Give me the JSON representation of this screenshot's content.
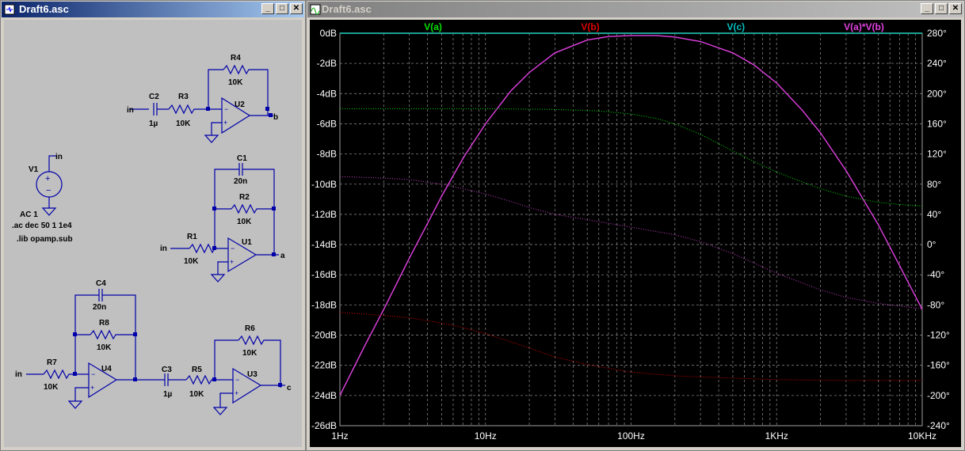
{
  "schematic_window": {
    "title": "Draft6.asc",
    "buttons": {
      "minimize": "_",
      "maximize": "□",
      "close": "✕"
    },
    "labels": {
      "r4": "R4",
      "r4_val": "10K",
      "c2": "C2",
      "c2_val": "1µ",
      "r3": "R3",
      "r3_val": "10K",
      "u2": "U2",
      "in1": "in",
      "out_b": "b",
      "v1": "V1",
      "v1_net": "in",
      "v1_ac": "AC 1",
      "ac_cmd": ".ac dec 50 1 1e4",
      "lib_cmd": ".lib opamp.sub",
      "c1": "C1",
      "c1_val": "20n",
      "r2": "R2",
      "r2_val": "10K",
      "r1": "R1",
      "r1_val": "10K",
      "in2": "in",
      "u1": "U1",
      "out_a": "a",
      "c4": "C4",
      "c4_val": "20n",
      "r8": "R8",
      "r8_val": "10K",
      "r7": "R7",
      "r7_val": "10K",
      "in3": "in",
      "u4": "U4",
      "c3": "C3",
      "c3_val": "1µ",
      "r5": "R5",
      "r5_val": "10K",
      "r6": "R6",
      "r6_val": "10K",
      "u3": "U3",
      "out_c": "c"
    }
  },
  "plot_window": {
    "title": "Draft6.asc",
    "buttons": {
      "minimize": "_",
      "maximize": "□",
      "close": "✕"
    },
    "trace_colors": {
      "V(a)": "#00e000",
      "V(b)": "#e00000",
      "V(c)": "#00c0c0",
      "V(a)*V(b)": "#e040e0"
    }
  },
  "chart_data": {
    "type": "line",
    "x_scale": "log",
    "xlim": [
      1,
      10000
    ],
    "xticks": [
      "1Hz",
      "10Hz",
      "100Hz",
      "1KHz",
      "10KHz"
    ],
    "ylim_left": [
      -26,
      0
    ],
    "yticks_left": [
      "0dB",
      "-2dB",
      "-4dB",
      "-6dB",
      "-8dB",
      "-10dB",
      "-12dB",
      "-14dB",
      "-16dB",
      "-18dB",
      "-20dB",
      "-22dB",
      "-24dB",
      "-26dB"
    ],
    "ylim_right": [
      -240,
      280
    ],
    "yticks_right": [
      "280°",
      "240°",
      "200°",
      "160°",
      "120°",
      "80°",
      "40°",
      "0°",
      "-40°",
      "-80°",
      "-120°",
      "-160°",
      "-200°",
      "-240°"
    ],
    "series": [
      {
        "name": "V(a)",
        "color": "#00e000",
        "style": "solid",
        "x": [
          1,
          10000
        ],
        "y": [
          0,
          0
        ]
      },
      {
        "name": "V(b)",
        "color": "#e00000",
        "style": "solid",
        "x": [
          1,
          10000
        ],
        "y": [
          0,
          0
        ]
      },
      {
        "name": "V(c)",
        "color": "#00c0c0",
        "style": "solid",
        "x": [
          1,
          10000
        ],
        "y": [
          0,
          0
        ]
      },
      {
        "name": "V(a)*V(b)",
        "color": "#e040e0",
        "style": "solid",
        "x": [
          1,
          1.5,
          2,
          3,
          4,
          5,
          7,
          10,
          15,
          20,
          30,
          50,
          70,
          100,
          150,
          200,
          300,
          500,
          700,
          1000,
          1500,
          2000,
          3000,
          5000,
          7000,
          10000
        ],
        "y": [
          -24,
          -20.6,
          -18.3,
          -14.9,
          -12.6,
          -10.8,
          -8.3,
          -6.0,
          -3.8,
          -2.6,
          -1.3,
          -0.45,
          -0.22,
          -0.15,
          -0.15,
          -0.25,
          -0.55,
          -1.3,
          -2.1,
          -3.3,
          -5.1,
          -6.6,
          -9.1,
          -12.7,
          -15.4,
          -18.3
        ]
      },
      {
        "name": "V(a) phase",
        "color": "#00e000",
        "style": "dotted",
        "axis": "right",
        "x": [
          1,
          3,
          10,
          30,
          60,
          100,
          150,
          200,
          300,
          500,
          700,
          1000,
          1500,
          2000,
          3000,
          5000,
          7000,
          10000
        ],
        "y": [
          180,
          180,
          180,
          179,
          177,
          173,
          167,
          160,
          146,
          124,
          110,
          96,
          83,
          74,
          64,
          56,
          53,
          51
        ]
      },
      {
        "name": "V(b) phase",
        "color": "#e00000",
        "style": "dotted",
        "axis": "right",
        "x": [
          1,
          2,
          3,
          5,
          7,
          10,
          15,
          20,
          30,
          50,
          70,
          100,
          200,
          500,
          1000,
          3000,
          10000
        ],
        "y": [
          -90,
          -94,
          -97,
          -104,
          -110,
          -118,
          -129,
          -137,
          -149,
          -159,
          -164,
          -169,
          -174,
          -177,
          -179,
          -180,
          -180
        ]
      },
      {
        "name": "V(c) phase",
        "color": "#c040c0",
        "style": "dotted",
        "axis": "right",
        "x": [
          1,
          2,
          3,
          5,
          7,
          10,
          15,
          20,
          30,
          50,
          100,
          200,
          300,
          500,
          1000,
          2000,
          3000,
          5000,
          10000
        ],
        "y": [
          90,
          88,
          86,
          80,
          74,
          67,
          57,
          49,
          40,
          33,
          23,
          13,
          4,
          -12,
          -38,
          -60,
          -70,
          -78,
          -85
        ]
      }
    ]
  }
}
